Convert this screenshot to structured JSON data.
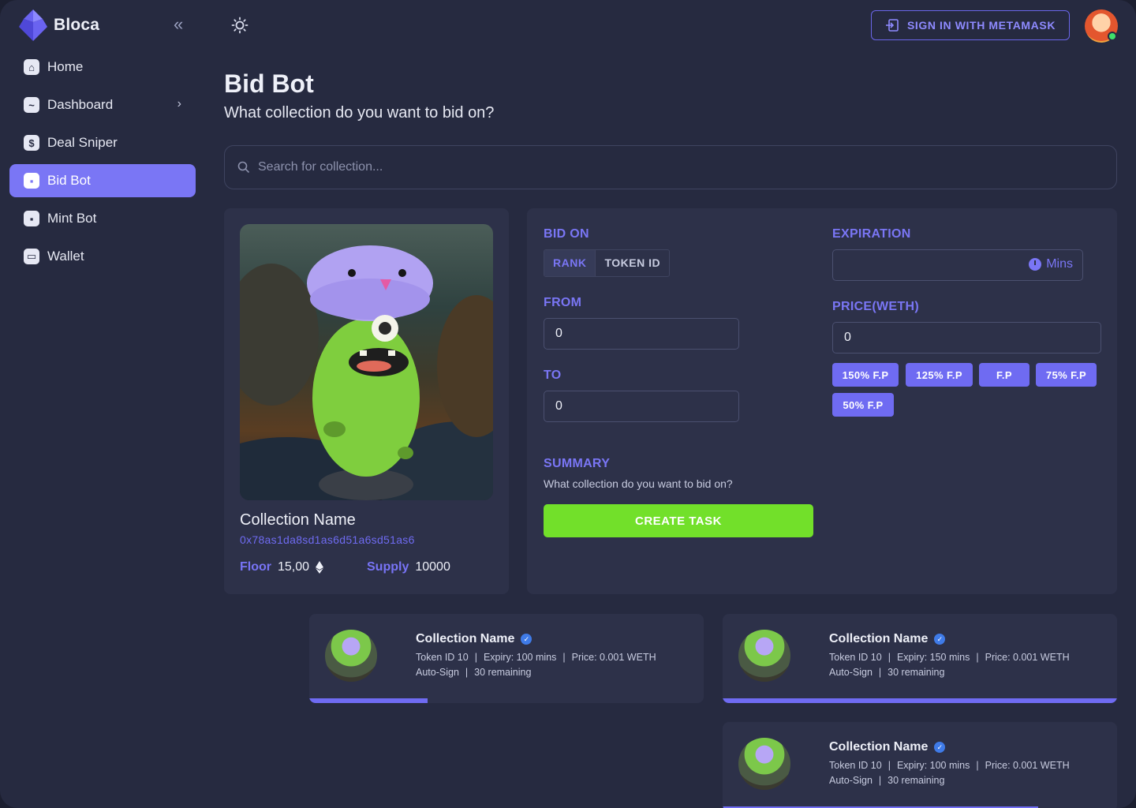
{
  "brand": {
    "name": "Bloca"
  },
  "sidebar": {
    "items": [
      {
        "label": "Home",
        "icon": "home-icon",
        "glyph": "⌂",
        "active": false
      },
      {
        "label": "Dashboard",
        "icon": "dashboard-icon",
        "glyph": "~",
        "active": false,
        "has_chevron": true
      },
      {
        "label": "Deal Sniper",
        "icon": "dollar-icon",
        "glyph": "$",
        "active": false
      },
      {
        "label": "Bid Bot",
        "icon": "bid-bot-icon",
        "glyph": "▪",
        "active": true
      },
      {
        "label": "Mint Bot",
        "icon": "mint-bot-icon",
        "glyph": "▪",
        "active": false
      },
      {
        "label": "Wallet",
        "icon": "wallet-icon",
        "glyph": "▭",
        "active": false
      }
    ]
  },
  "topbar": {
    "signin_label": "SIGN IN WITH METAMASK"
  },
  "header": {
    "title": "Bid Bot",
    "subtitle": "What collection do you want to bid on?"
  },
  "search": {
    "placeholder": "Search for collection...",
    "value": ""
  },
  "collection": {
    "name": "Collection Name",
    "address": "0x78as1da8sd1as6d51a6sd51as6",
    "floor_label": "Floor",
    "floor_value": "15,00",
    "supply_label": "Supply",
    "supply_value": "10000"
  },
  "form": {
    "bid_on_label": "BID ON",
    "bid_on_options": [
      "RANK",
      "TOKEN ID"
    ],
    "bid_on_selected": "RANK",
    "from_label": "FROM",
    "from_value": "0",
    "to_label": "TO",
    "to_value": "0",
    "expiration_label": "EXPIRATION",
    "expiration_value": "",
    "expiration_unit": "Mins",
    "price_label": "PRICE(WETH)",
    "price_value": "0",
    "price_presets": [
      "150% F.P",
      "125% F.P",
      "F.P",
      "75% F.P",
      "50% F.P"
    ],
    "summary_label": "SUMMARY",
    "summary_text": "What collection do you want to bid on?",
    "create_label": "CREATE TASK"
  },
  "tasks": [
    {
      "name": "Collection Name",
      "token": "Token ID 10",
      "expiry": "Expiry: 100 mins",
      "price": "Price: 0.001 WETH",
      "sign": "Auto-Sign",
      "remaining": "30 remaining",
      "progress": 0.3
    },
    {
      "name": "Collection Name",
      "token": "Token ID 10",
      "expiry": "Expiry: 150 mins",
      "price": "Price: 0.001 WETH",
      "sign": "Auto-Sign",
      "remaining": "30 remaining",
      "progress": 1.0
    },
    {
      "name": "Collection Name",
      "token": "Token ID 10",
      "expiry": "Expiry: 100 mins",
      "price": "Price: 0.001 WETH",
      "sign": "Auto-Sign",
      "remaining": "30 remaining",
      "progress": 0.8
    }
  ],
  "colors": {
    "accent": "#6f6bf2",
    "create_green": "#72e02a",
    "background": "#262a40",
    "card": "#2d3149"
  }
}
